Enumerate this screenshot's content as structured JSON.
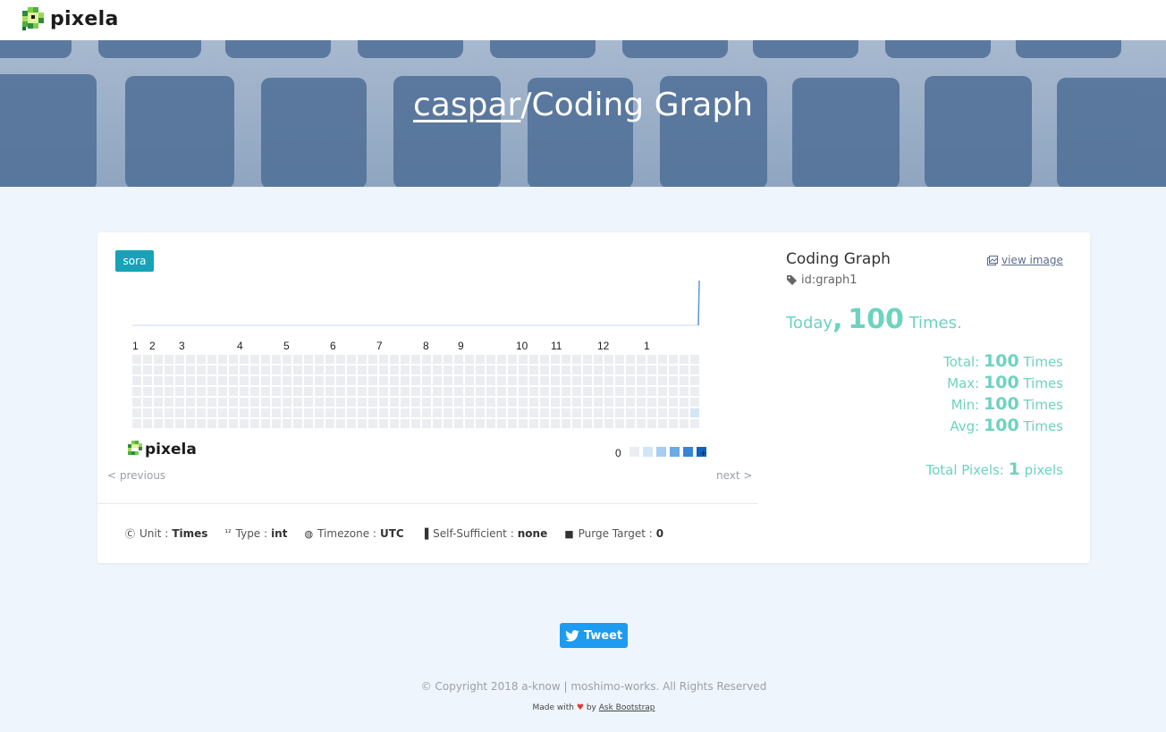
{
  "navbar": {
    "brand": "pixela"
  },
  "hero": {
    "username": "caspar",
    "separator": "/",
    "graph_name": "Coding Graph"
  },
  "graph": {
    "badge": "sora",
    "months": [
      "1",
      "2",
      "3",
      "4",
      "5",
      "6",
      "7",
      "8",
      "9",
      "10",
      "11",
      "12",
      "1"
    ],
    "legend_min": "0",
    "legend_max": "+",
    "brand": "pixela",
    "prev": "< previous",
    "next": "next >",
    "colors": {
      "empty": "#ebedf0",
      "l1": "#d4e5f7",
      "l2": "#a8cdf0",
      "l3": "#6aaae6",
      "l4": "#3586d6",
      "l5": "#0f62c2",
      "accent": "#6dd3c0"
    }
  },
  "meta": {
    "unit_label": "Unit",
    "unit_value": "Times",
    "type_label": "Type",
    "type_value": "int",
    "timezone_label": "Timezone",
    "timezone_value": "UTC",
    "self_label": "Self-Sufficient",
    "self_value": "none",
    "purge_label": "Purge Target",
    "purge_value": "0",
    "sep": ":"
  },
  "panel": {
    "title": "Coding Graph",
    "view_image": "view image",
    "id": "id:graph1",
    "today_label": "Today",
    "today_sep": ",",
    "today_value": "100",
    "today_unit": "Times.",
    "total_label": "Total:",
    "total_value": "100",
    "total_unit": "Times",
    "max_label": "Max:",
    "max_value": "100",
    "max_unit": "Times",
    "min_label": "Min:",
    "min_value": "100",
    "min_unit": "Times",
    "avg_label": "Avg:",
    "avg_value": "100",
    "avg_unit": "Times",
    "pixels_label": "Total Pixels:",
    "pixels_value": "1",
    "pixels_unit": "pixels"
  },
  "footer": {
    "tweet": "Tweet",
    "copyright": "© Copyright 2018 a-know | moshimo-works. All Rights Reserved",
    "made_with": "Made with",
    "by": "by",
    "ask_bootstrap": "Ask Bootstrap"
  }
}
